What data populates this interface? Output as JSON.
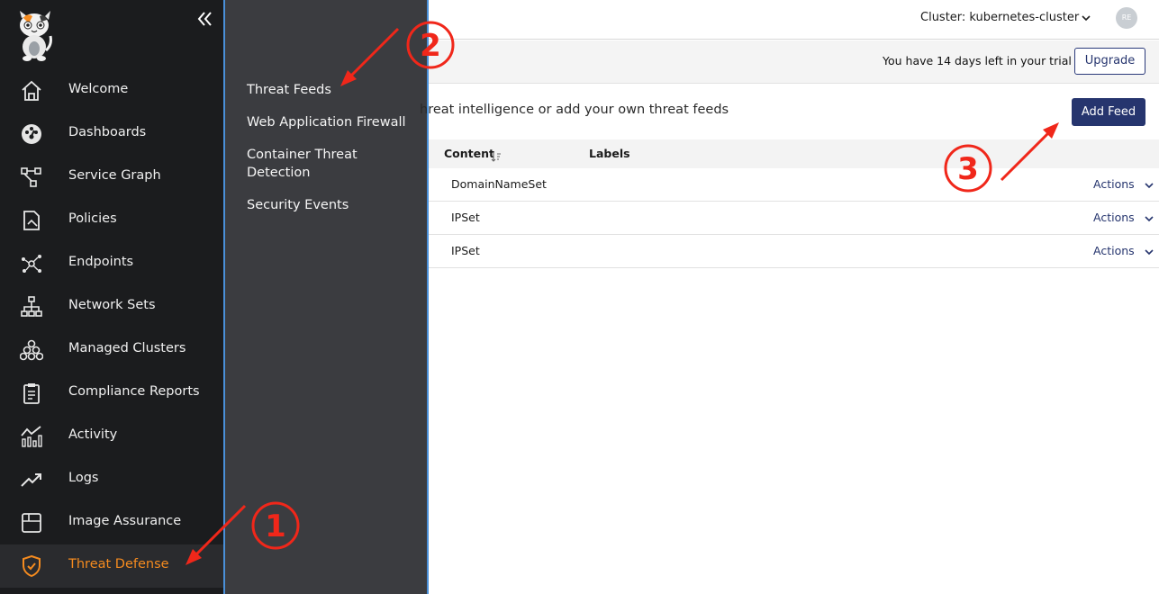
{
  "colors": {
    "sidebar_bg": "#1b1c1e",
    "flyout_bg": "#3b3c40",
    "active": "#f58b1f",
    "primary": "#26356e",
    "annotation": "#f0271a"
  },
  "sidebar": {
    "collapse_icon": "double-chevron-left-icon",
    "items": [
      {
        "label": "Welcome",
        "icon": "home-icon"
      },
      {
        "label": "Dashboards",
        "icon": "dashboard-icon"
      },
      {
        "label": "Service Graph",
        "icon": "service-graph-icon"
      },
      {
        "label": "Policies",
        "icon": "policies-icon"
      },
      {
        "label": "Endpoints",
        "icon": "endpoints-icon"
      },
      {
        "label": "Network Sets",
        "icon": "network-sets-icon"
      },
      {
        "label": "Managed Clusters",
        "icon": "managed-clusters-icon"
      },
      {
        "label": "Compliance Reports",
        "icon": "clipboard-icon"
      },
      {
        "label": "Activity",
        "icon": "activity-chart-icon"
      },
      {
        "label": "Logs",
        "icon": "trend-arrow-icon"
      },
      {
        "label": "Image Assurance",
        "icon": "box-icon"
      },
      {
        "label": "Threat Defense",
        "icon": "shield-check-icon",
        "active": true
      }
    ]
  },
  "submenu": {
    "items": [
      {
        "label": "Threat Feeds"
      },
      {
        "label": "Web Application Firewall"
      },
      {
        "label": "Container Threat Detection"
      },
      {
        "label": "Security Events"
      }
    ]
  },
  "header": {
    "cluster_label": "Cluster: kubernetes-cluster",
    "avatar_initials": "RE"
  },
  "banner": {
    "trial_text": "You have 14 days left in your trial",
    "upgrade_label": "Upgrade"
  },
  "main": {
    "intro_text": "hreat intelligence or add your own threat feeds",
    "add_feed_label": "Add Feed",
    "table": {
      "columns": [
        "Content",
        "Labels"
      ],
      "rows": [
        {
          "content": "DomainNameSet",
          "labels": "",
          "actions": "Actions"
        },
        {
          "content": "IPSet",
          "labels": "",
          "actions": "Actions"
        },
        {
          "content": "IPSet",
          "labels": "",
          "actions": "Actions"
        }
      ]
    }
  },
  "annotations": {
    "step1": "1",
    "step2": "2",
    "step3": "3"
  }
}
